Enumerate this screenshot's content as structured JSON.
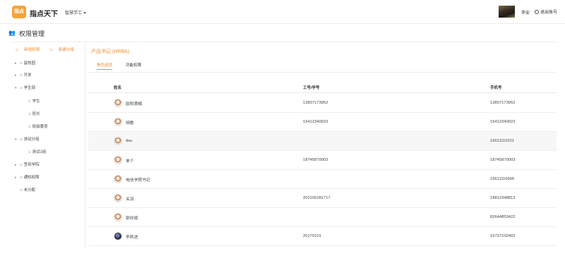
{
  "header": {
    "logo_text": "指点",
    "brand": "指点天下",
    "nav_label": "智慧学工",
    "user_name": "李安",
    "logout_label": "退出账号"
  },
  "page": {
    "title": "权限管理"
  },
  "sidebar": {
    "add_permission": "新增权限",
    "add_group": "新建分组",
    "items": [
      {
        "label": "留校园",
        "arrow": "▸"
      },
      {
        "label": "开发",
        "arrow": "▸"
      },
      {
        "label": "学生部",
        "arrow": "▾"
      },
      {
        "label": "学生",
        "arrow": ""
      },
      {
        "label": "班长",
        "arrow": ""
      },
      {
        "label": "班级委员",
        "arrow": ""
      },
      {
        "label": "测试分组",
        "arrow": "▾"
      },
      {
        "label": "测试1组",
        "arrow": ""
      },
      {
        "label": "签到学院",
        "arrow": "▸"
      },
      {
        "label": "通知权限",
        "arrow": "▸"
      },
      {
        "label": "未分配",
        "arrow": ""
      }
    ]
  },
  "main": {
    "product_title": "产品书记 (HRBA)",
    "tabs": [
      {
        "label": "角色成员",
        "active": true
      },
      {
        "label": "功能权限",
        "active": false
      }
    ],
    "columns": [
      "姓名",
      "工号/学号",
      "手机号"
    ],
    "rows": [
      {
        "name": "欧阳惠楠",
        "id": "13837173952",
        "phone": "13837173952"
      },
      {
        "name": "胡歌",
        "id": "15412340023",
        "phone": "15412340023"
      },
      {
        "name": "dsu",
        "id": "",
        "phone": "16611110221"
      },
      {
        "name": "单个",
        "id": "18745870003",
        "phone": "18745870003"
      },
      {
        "name": "电信学院书记",
        "id": "",
        "phone": "16611116666"
      },
      {
        "name": "关羽",
        "id": "202105281717",
        "phone": "18812348813"
      },
      {
        "name": "郭向斌",
        "id": "",
        "phone": "82644853422"
      },
      {
        "name": "李莉进",
        "id": "20170101",
        "phone": "15737102402"
      }
    ]
  },
  "colors": {
    "accent": "#f08c2c",
    "logo": "#f7a23b"
  }
}
